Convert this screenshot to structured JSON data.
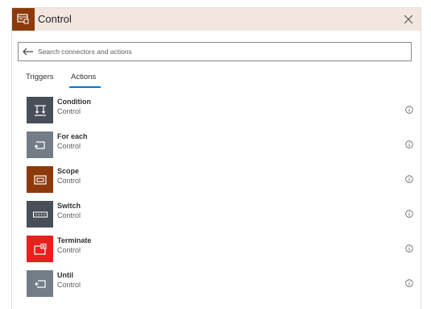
{
  "header": {
    "title": "Control",
    "accent_color": "#8c3a0b",
    "band_color": "#f1e6e0"
  },
  "search": {
    "placeholder": "Search connectors and actions",
    "value": ""
  },
  "tabs": [
    {
      "label": "Triggers",
      "selected": false
    },
    {
      "label": "Actions",
      "selected": true
    }
  ],
  "actions": [
    {
      "title": "Condition",
      "subtitle": "Control",
      "icon": "condition-icon",
      "color": "#484f58"
    },
    {
      "title": "For each",
      "subtitle": "Control",
      "icon": "loop-icon",
      "color": "#737d87"
    },
    {
      "title": "Scope",
      "subtitle": "Control",
      "icon": "scope-icon",
      "color": "#8c3a0b"
    },
    {
      "title": "Switch",
      "subtitle": "Control",
      "icon": "switch-icon",
      "color": "#484f58"
    },
    {
      "title": "Terminate",
      "subtitle": "Control",
      "icon": "terminate-icon",
      "color": "#e8211f"
    },
    {
      "title": "Until",
      "subtitle": "Control",
      "icon": "until-icon",
      "color": "#737d87"
    }
  ]
}
